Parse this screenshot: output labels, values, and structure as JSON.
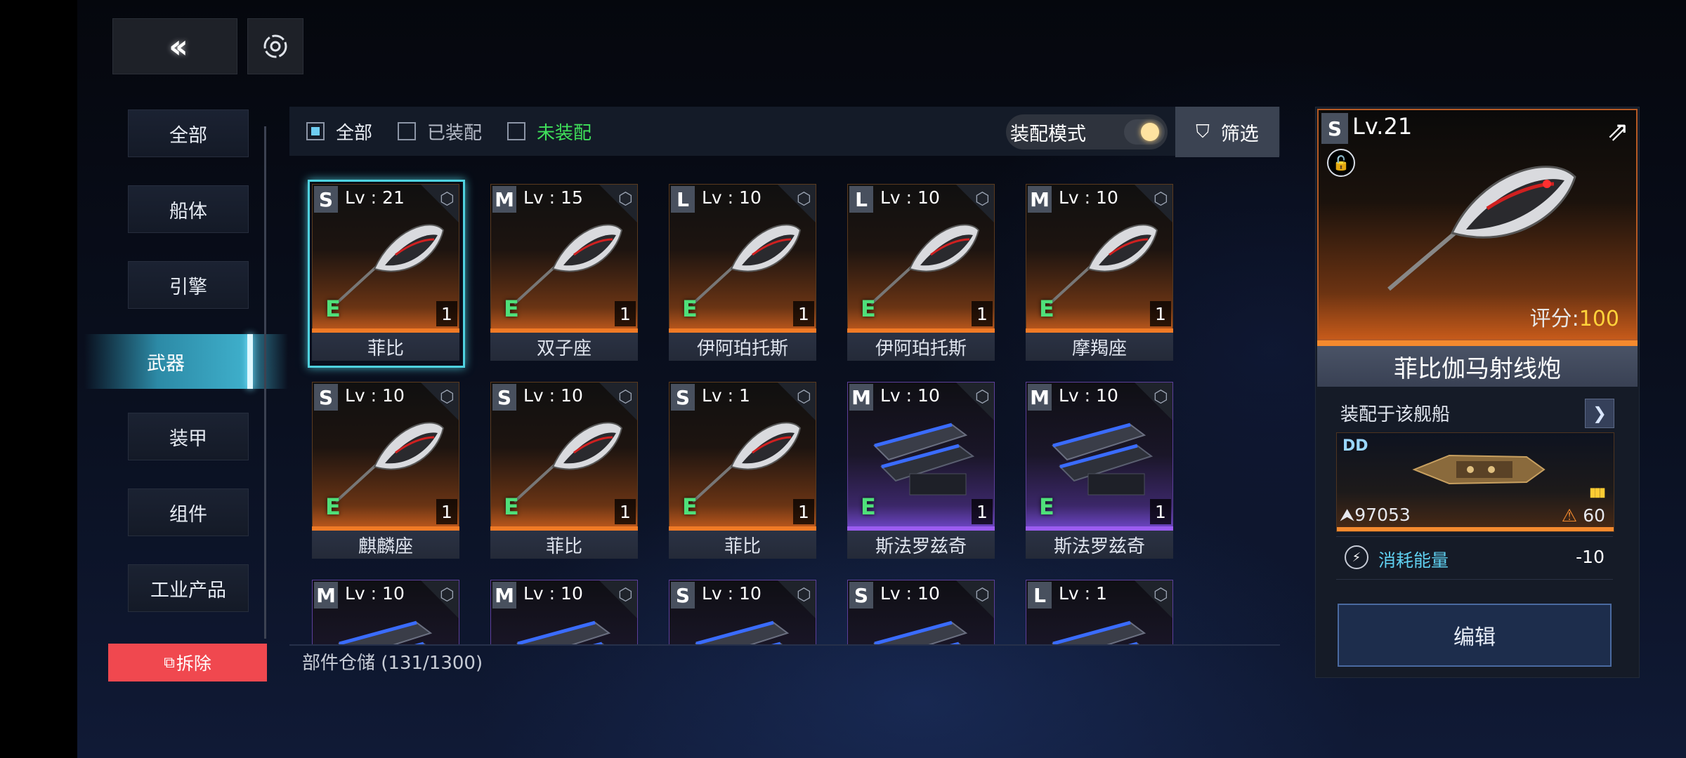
{
  "top": {
    "back_icon": "double-chevron-left",
    "gear_icon": "settings-gear"
  },
  "sidebar": {
    "items": [
      {
        "label": "全部"
      },
      {
        "label": "船体"
      },
      {
        "label": "引擎"
      },
      {
        "label": "武器",
        "active": true
      },
      {
        "label": "装甲"
      },
      {
        "label": "组件"
      },
      {
        "label": "工业产品"
      }
    ],
    "demolish_label": "拆除",
    "demolish_icon": "demolish-icon"
  },
  "filter": {
    "all_label": "全部",
    "equipped_label": "已装配",
    "unequipped_label": "未装配",
    "mode_label": "装配模式",
    "filter_label": "筛选"
  },
  "items": [
    {
      "size": "S",
      "lv": "Lv : 21",
      "grade": "E",
      "qty": "1",
      "name": "菲比",
      "color": "orange",
      "selected": true
    },
    {
      "size": "M",
      "lv": "Lv : 15",
      "grade": "E",
      "qty": "1",
      "name": "双子座",
      "color": "orange"
    },
    {
      "size": "L",
      "lv": "Lv : 10",
      "grade": "E",
      "qty": "1",
      "name": "伊阿珀托斯",
      "color": "orange"
    },
    {
      "size": "L",
      "lv": "Lv : 10",
      "grade": "E",
      "qty": "1",
      "name": "伊阿珀托斯",
      "color": "orange"
    },
    {
      "size": "M",
      "lv": "Lv : 10",
      "grade": "E",
      "qty": "1",
      "name": "摩羯座",
      "color": "orange"
    },
    {
      "size": "S",
      "lv": "Lv : 10",
      "grade": "E",
      "qty": "1",
      "name": "麒麟座",
      "color": "orange"
    },
    {
      "size": "S",
      "lv": "Lv : 10",
      "grade": "E",
      "qty": "1",
      "name": "菲比",
      "color": "orange"
    },
    {
      "size": "S",
      "lv": "Lv : 1",
      "grade": "E",
      "qty": "1",
      "name": "菲比",
      "color": "orange"
    },
    {
      "size": "M",
      "lv": "Lv : 10",
      "grade": "E",
      "qty": "1",
      "name": "斯法罗兹奇",
      "color": "purple"
    },
    {
      "size": "M",
      "lv": "Lv : 10",
      "grade": "E",
      "qty": "1",
      "name": "斯法罗兹奇",
      "color": "purple"
    },
    {
      "size": "M",
      "lv": "Lv : 10",
      "grade": "",
      "qty": "",
      "name": "",
      "color": "purple"
    },
    {
      "size": "M",
      "lv": "Lv : 10",
      "grade": "",
      "qty": "",
      "name": "",
      "color": "purple"
    },
    {
      "size": "S",
      "lv": "Lv : 10",
      "grade": "",
      "qty": "",
      "name": "",
      "color": "purple"
    },
    {
      "size": "S",
      "lv": "Lv : 10",
      "grade": "",
      "qty": "",
      "name": "",
      "color": "purple"
    },
    {
      "size": "L",
      "lv": "Lv : 1",
      "grade": "",
      "qty": "",
      "name": "",
      "color": "purple"
    }
  ],
  "storage": "部件仓储 (131/1300)",
  "detail": {
    "size": "S",
    "level": "Lv.21",
    "score_label": "评分:",
    "score_value": "100",
    "name": "菲比伽马射线炮",
    "equipped_label": "装配于该舰船",
    "ship_class": "DD",
    "ship_power": "97053",
    "ship_warning": "60",
    "energy_label": "消耗能量",
    "energy_value": "-10",
    "edit_label": "编辑"
  },
  "colors": {
    "accent": "#4fd2e0",
    "orange_rarity": "#f07a26",
    "purple_rarity": "#9b5cf0",
    "grade_green": "#4fe07a",
    "unequipped_green": "#3fe05a",
    "demolish_red": "#f0484f",
    "score_yellow": "#ffd23a"
  }
}
